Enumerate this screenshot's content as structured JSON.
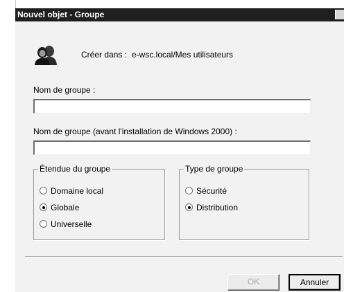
{
  "window": {
    "title": "Nouvel objet - Groupe"
  },
  "header": {
    "create_in_label": "Créer dans :",
    "create_in_path": "e-wsc.local/Mes utilisateurs"
  },
  "fields": {
    "group_name": {
      "label": "Nom de groupe :",
      "value": ""
    },
    "group_name_pre2000": {
      "label": "Nom de groupe (avant l'installation de Windows 2000) :",
      "value": ""
    }
  },
  "scope": {
    "legend": "Étendue du groupe",
    "options": [
      {
        "label": "Domaine local",
        "checked": false
      },
      {
        "label": "Globale",
        "checked": true
      },
      {
        "label": "Universelle",
        "checked": false
      }
    ]
  },
  "type": {
    "legend": "Type de groupe",
    "options": [
      {
        "label": "Sécurité",
        "checked": false
      },
      {
        "label": "Distribution",
        "checked": true
      }
    ]
  },
  "buttons": {
    "ok": "OK",
    "cancel": "Annuler"
  },
  "icons": {
    "group": "group-users-icon"
  }
}
